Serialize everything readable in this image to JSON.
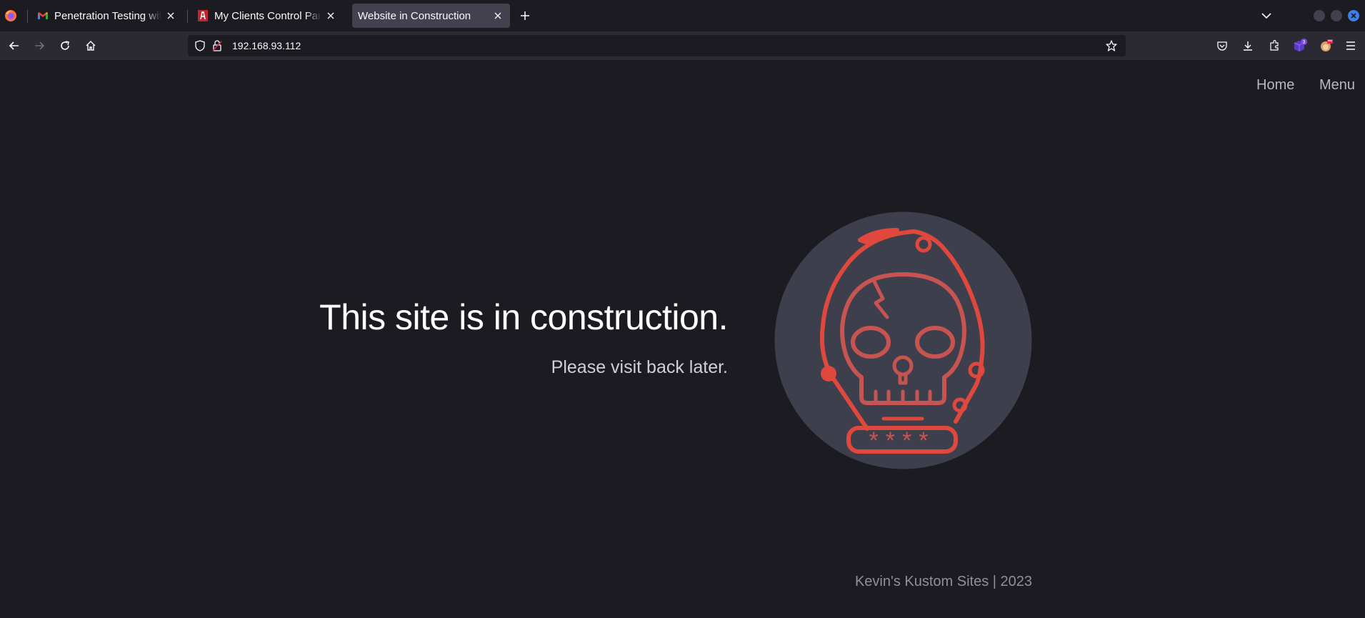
{
  "browser": {
    "tabs": [
      {
        "title": "Penetration Testing with Kali Linux",
        "favicon": "gmail-icon",
        "active": false
      },
      {
        "title": "My Clients Control Panel",
        "favicon": "control-panel-icon",
        "active": false
      },
      {
        "title": "Website in Construction",
        "favicon": "none",
        "active": true
      }
    ],
    "url": "192.168.93.112",
    "extension_badge": "3"
  },
  "page": {
    "nav": {
      "home": "Home",
      "menu": "Menu"
    },
    "headline": "This site is in construction.",
    "subline": "Please visit back later.",
    "badge_mask": "****",
    "footer": "Kevin's Kustom Sites | 2023"
  },
  "colors": {
    "background": "#1c1b22",
    "badge_circle": "#3d3f4d",
    "accent_red": "#e0483e"
  }
}
